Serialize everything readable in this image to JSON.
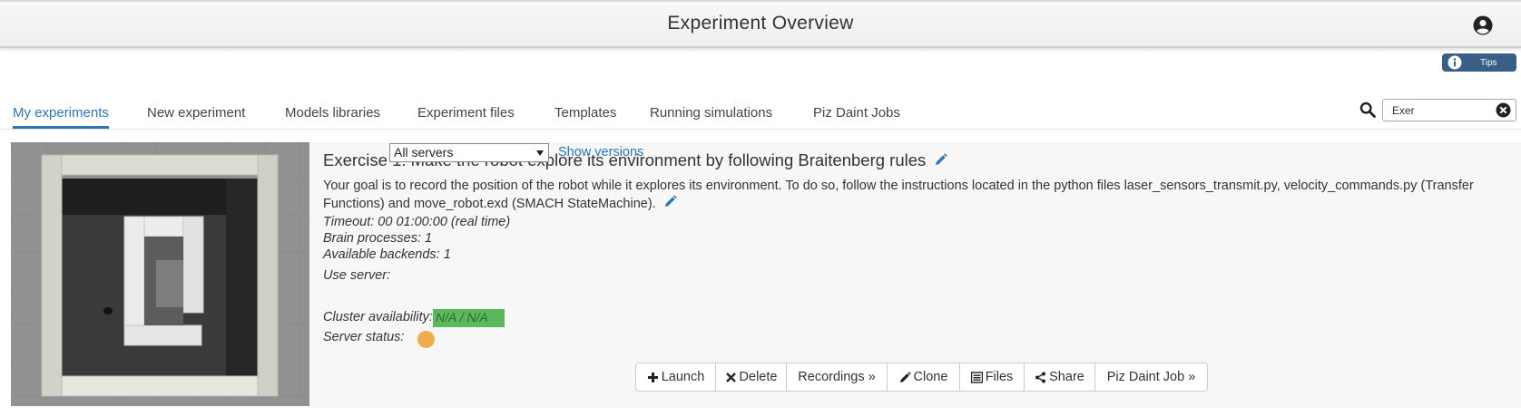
{
  "header": {
    "title": "Experiment Overview",
    "user_icon": "user-circle-icon"
  },
  "tips": {
    "label": "Tips",
    "icon": "info-circle-icon"
  },
  "tabs": [
    {
      "label": "My experiments",
      "active": true
    },
    {
      "label": "New experiment",
      "active": false
    },
    {
      "label": "Models libraries",
      "active": false
    },
    {
      "label": "Experiment files",
      "active": false
    },
    {
      "label": "Templates",
      "active": false
    },
    {
      "label": "Running simulations",
      "active": false
    },
    {
      "label": "Piz Daint Jobs",
      "active": false
    }
  ],
  "search": {
    "value": "Exer",
    "icon": "search-icon",
    "clear_icon": "close-circle-icon"
  },
  "experiment": {
    "title": "Exercise 1: Make the robot explore its environment by following Braitenberg rules",
    "description": "Your goal is to record the position of the robot while it explores its environment. To do so, follow the instructions located in the python files laser_sensors_transmit.py, velocity_commands.py (Transfer Functions) and move_robot.exd (SMACH StateMachine).",
    "timeout": "Timeout: 00 01:00:00 (real time)",
    "brain_processes": "Brain processes: 1",
    "available_backends": "Available backends: 1",
    "use_server_label": "Use server:",
    "server_selected": "All servers",
    "show_versions": "Show versions",
    "cluster_label": "Cluster availability:",
    "cluster_value": "N/A / N/A",
    "server_status_label": "Server status:",
    "server_status_color": "#f0ad4e"
  },
  "actions": {
    "launch": "Launch",
    "delete": "Delete",
    "recordings": "Recordings »",
    "clone": "Clone",
    "files": "Files",
    "share": "Share",
    "piz_daint_job": "Piz Daint Job »"
  },
  "colors": {
    "accent": "#2f74b5",
    "tips_bg": "#3a5f87",
    "cluster_ok": "#5cb85c"
  }
}
